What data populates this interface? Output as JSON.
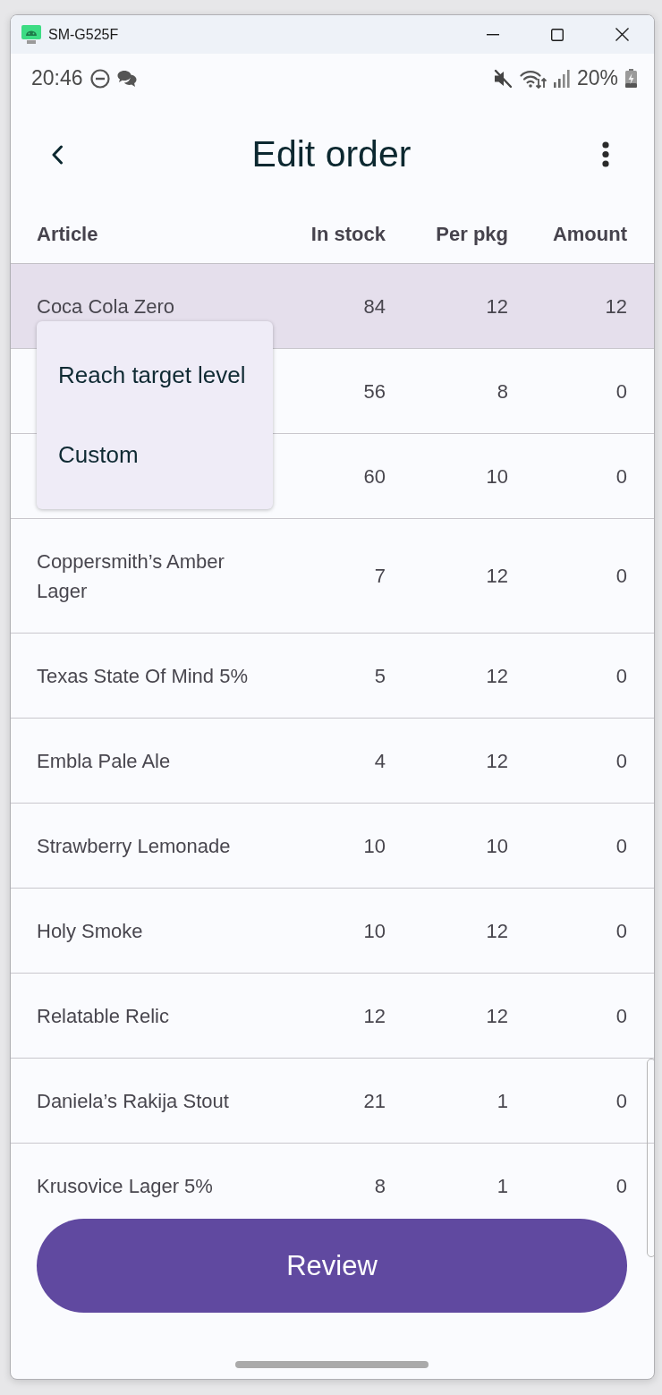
{
  "window": {
    "title": "SM-G525F"
  },
  "status_bar": {
    "time": "20:46",
    "battery": "20%"
  },
  "app_bar": {
    "title": "Edit order"
  },
  "table": {
    "columns": [
      "Article",
      "In stock",
      "Per pkg",
      "Amount"
    ],
    "rows": [
      {
        "article": "Coca Cola Zero",
        "in_stock": "84",
        "per_pkg": "12",
        "amount": "12",
        "selected": true
      },
      {
        "in_stock": "56",
        "per_pkg": "8",
        "amount": "0",
        "selected": false
      },
      {
        "in_stock": "60",
        "per_pkg": "10",
        "amount": "0",
        "selected": false
      },
      {
        "article": "Coppersmith’s Amber Lager",
        "in_stock": "7",
        "per_pkg": "12",
        "amount": "0",
        "selected": false
      },
      {
        "article": "Texas State Of Mind 5%",
        "in_stock": "5",
        "per_pkg": "12",
        "amount": "0",
        "selected": false
      },
      {
        "article": "Embla Pale Ale",
        "in_stock": "4",
        "per_pkg": "12",
        "amount": "0",
        "selected": false
      },
      {
        "article": "Strawberry Lemonade",
        "in_stock": "10",
        "per_pkg": "10",
        "amount": "0",
        "selected": false
      },
      {
        "article": "Holy Smoke",
        "in_stock": "10",
        "per_pkg": "12",
        "amount": "0",
        "selected": false
      },
      {
        "article": "Relatable Relic",
        "in_stock": "12",
        "per_pkg": "12",
        "amount": "0",
        "selected": false
      },
      {
        "article": "Daniela’s Rakija Stout",
        "in_stock": "21",
        "per_pkg": "1",
        "amount": "0",
        "selected": false
      },
      {
        "article": "Krusovice Lager 5%",
        "in_stock": "8",
        "per_pkg": "1",
        "amount": "0",
        "selected": false
      }
    ]
  },
  "menu": {
    "items": [
      "Reach target level",
      "Custom"
    ]
  },
  "review_button": "Review"
}
